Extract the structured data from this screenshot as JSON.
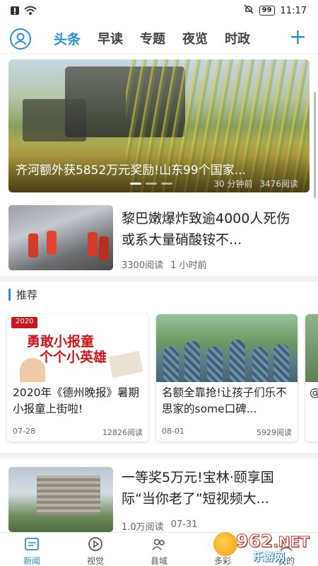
{
  "status": {
    "battery": "99",
    "time": "11:17"
  },
  "nav": {
    "tabs": [
      "头条",
      "早读",
      "专题",
      "夜览",
      "时政"
    ],
    "active": 0
  },
  "hero": {
    "title": "齐河额外获5852万元奖励!山东99个国家...",
    "time": "30 分钟前",
    "reads": "3476阅读"
  },
  "articles": [
    {
      "title": "黎巴嫩爆炸致逾4000人死伤 或系大量硝酸铵不...",
      "reads": "3300阅读",
      "time": "1 小时前"
    },
    {
      "title": "一等奖5万元!宝林·颐享国际“当你老了”短视频大...",
      "reads": "1.0万阅读",
      "time": "07-31"
    }
  ],
  "recommend": {
    "label": "推荐",
    "cards": [
      {
        "title": "2020年《德州晚报》暑期小报童上街啦!",
        "date": "07-28",
        "reads": "12826阅读",
        "poster_year": "2020",
        "poster_line1": "勇敢小报童",
        "poster_line2": "个个小英雄"
      },
      {
        "title": "名额全靠抢!让孩子们乐不思家的some口碑...",
        "date": "08-01",
        "reads": "5929阅读"
      }
    ],
    "partial": "@"
  },
  "tabbar": {
    "items": [
      "新闻",
      "视觉",
      "县域",
      "多彩",
      "我的"
    ],
    "active": 0
  },
  "watermark": {
    "number": "962",
    "net": ".NET",
    "site": "乐游网"
  }
}
